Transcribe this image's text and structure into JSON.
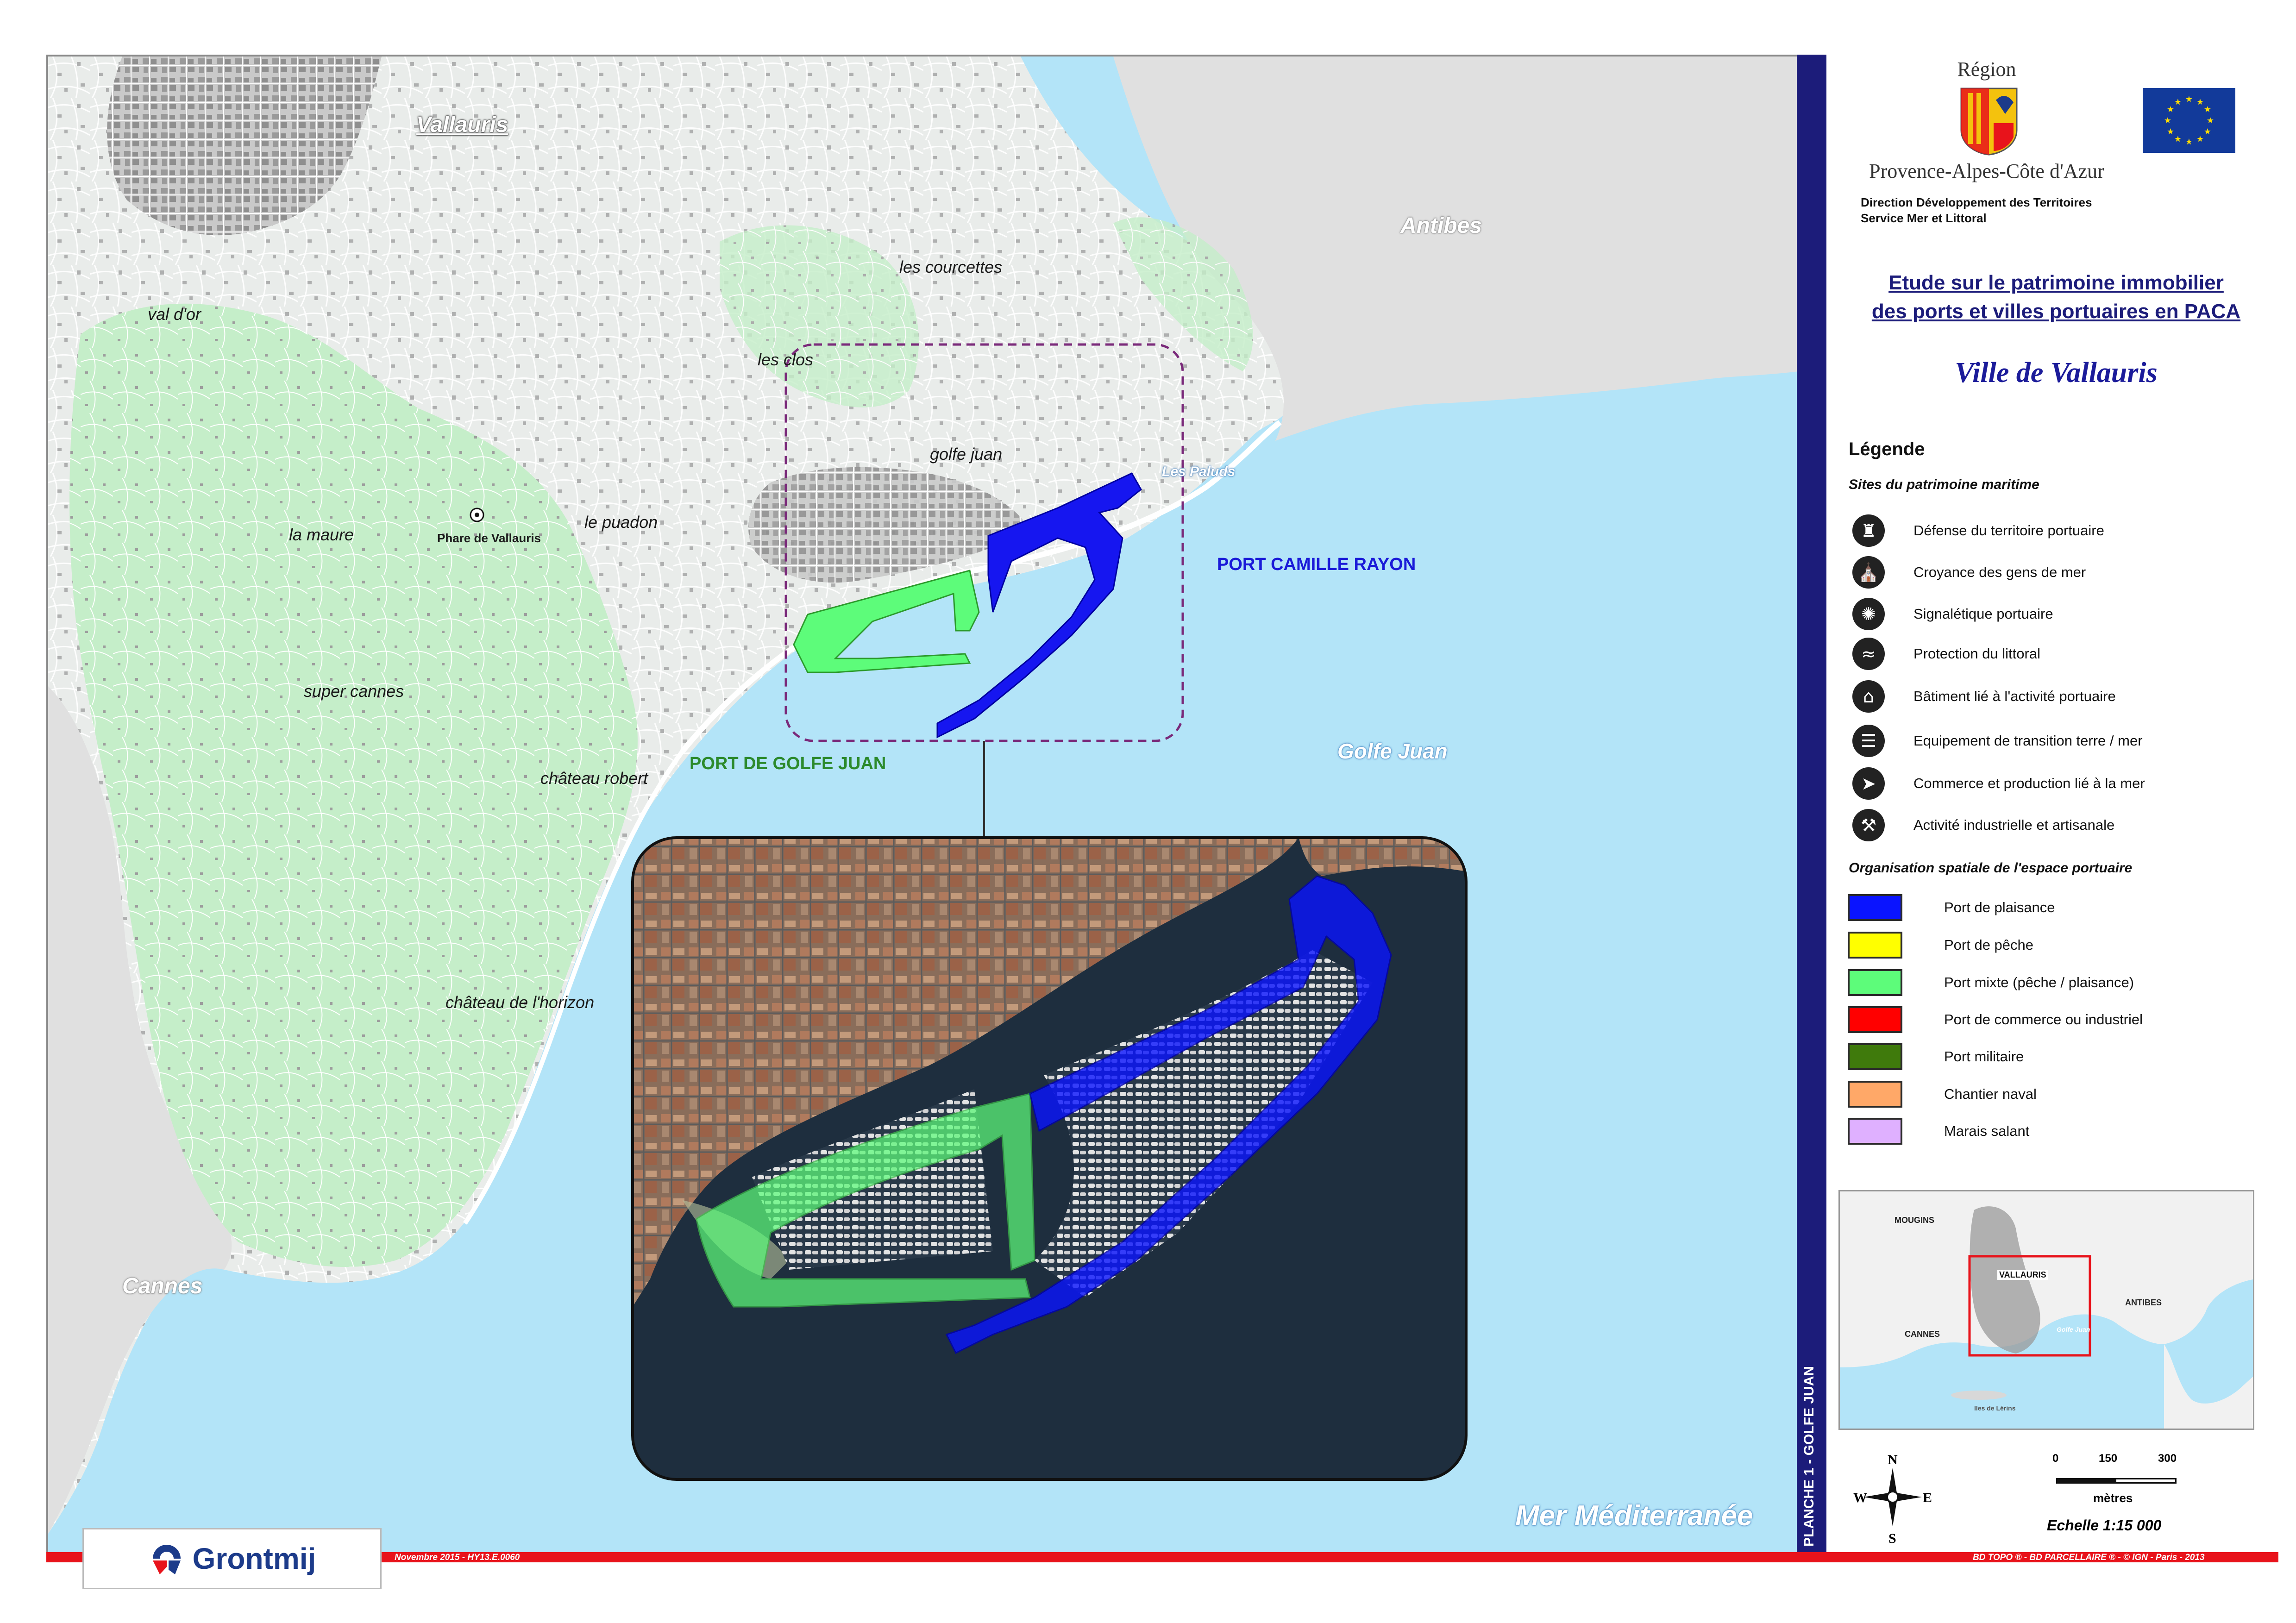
{
  "map": {
    "town": "Vallauris",
    "places": [
      "val d'or",
      "la maure",
      "super cannes",
      "château robert",
      "château de l'horizon",
      "le puadon",
      "les clos",
      "les courcettes",
      "golfe juan"
    ],
    "lighthouse": "Phare de Vallauris",
    "cities": {
      "antibes": "Antibes",
      "cannes": "Cannes"
    },
    "sea": {
      "paluds": "Les Paluds",
      "golfe_juan": "Golfe Juan",
      "mer": "Mer Méditerranée"
    },
    "ports": {
      "camille_rayon": "PORT CAMILLE RAYON",
      "golfe_juan": "PORT DE GOLFE JUAN"
    }
  },
  "panel": {
    "region_top": "Région",
    "region_bottom": "Provence-Alpes-Côte d'Azur",
    "direction_line1": "Direction Développement des Territoires",
    "direction_line2": "Service Mer et Littoral",
    "study_title_line1": "Etude sur le patrimoine immobilier",
    "study_title_line2": "des ports et villes portuaires en PACA",
    "city_title": "Ville de Vallauris",
    "legend_title": "Légende",
    "sites_title": "Sites du patrimoine maritime",
    "sites": [
      {
        "icon": "fortress-icon",
        "glyph": "♜",
        "label": "Défense du territoire portuaire"
      },
      {
        "icon": "chapel-icon",
        "glyph": "⛪",
        "label": "Croyance des gens de mer"
      },
      {
        "icon": "lighthouse-icon",
        "glyph": "✺",
        "label": "Signalétique portuaire"
      },
      {
        "icon": "seawall-icon",
        "glyph": "≈",
        "label": "Protection du littoral"
      },
      {
        "icon": "building-icon",
        "glyph": "⌂",
        "label": "Bâtiment lié à l'activité portuaire"
      },
      {
        "icon": "slipway-icon",
        "glyph": "☰",
        "label": "Equipement de transition terre / mer"
      },
      {
        "icon": "fish-icon",
        "glyph": "➤",
        "label": "Commerce et production lié à la mer"
      },
      {
        "icon": "factory-icon",
        "glyph": "⚒",
        "label": "Activité industrielle et artisanale"
      }
    ],
    "organisation_title": "Organisation spatiale de l'espace portuaire",
    "zones": [
      {
        "color": "#0a14ff",
        "label": "Port de plaisance"
      },
      {
        "color": "#ffff00",
        "label": "Port de pêche"
      },
      {
        "color": "#5dfc7a",
        "label": "Port mixte (pêche / plaisance)"
      },
      {
        "color": "#ff0000",
        "label": "Port de commerce ou industriel"
      },
      {
        "color": "#3f7a0c",
        "label": "Port militaire"
      },
      {
        "color": "#ffa868",
        "label": "Chantier naval"
      },
      {
        "color": "#dfb0ff",
        "label": "Marais salant"
      }
    ],
    "inset": {
      "mougins": "MOUGINS",
      "vallauris": "VALLAURIS",
      "cannes": "CANNES",
      "antibes": "ANTIBES",
      "golfe": "Golfe Juan",
      "iles": "Iles de Lérins"
    },
    "compass": {
      "n": "N",
      "s": "S",
      "e": "E",
      "w": "W"
    },
    "scale": {
      "t0": "0",
      "t1": "150",
      "t2": "300",
      "unit": "mètres",
      "echelle": "Echelle 1:15 000"
    },
    "planche": "PLANCHE 1 - GOLFE JUAN"
  },
  "footer": {
    "company": "Grontmij",
    "date_ref": "Novembre 2015 - HY13.E.0060",
    "source": "BD TOPO ® - BD PARCELLAIRE ® - © IGN - Paris - 2013"
  },
  "colors": {
    "sea": "#b3e4f8",
    "land": "#e9ecea",
    "vegetation": "#c5eec9",
    "plaisance": "#0a14ff",
    "mixte": "#5dfc7a",
    "frame_bar": "#1c1c7a",
    "footer_red": "#e8131b"
  }
}
